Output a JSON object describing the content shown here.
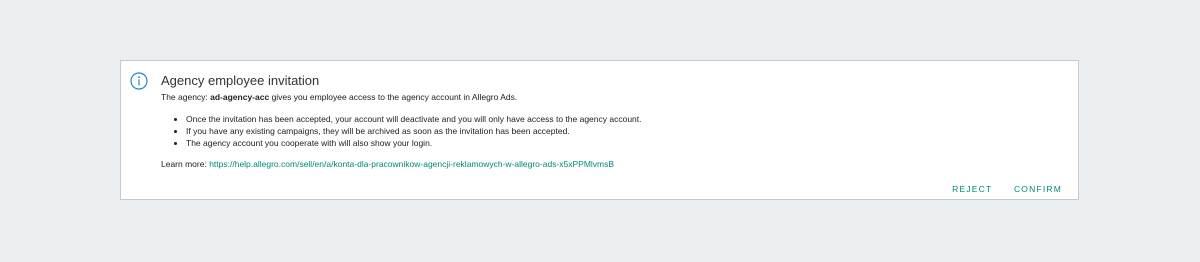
{
  "invitation": {
    "title": "Agency employee invitation",
    "desc_prefix": "The agency: ",
    "agency_name": "ad-agency-acc",
    "desc_suffix": " gives you employee access to the agency account in Allegro Ads.",
    "bullets": [
      "Once the invitation has been accepted, your account will deactivate and you will only have access to the agency account.",
      "If you have any existing campaigns, they will be archived as soon as the invitation has been accepted.",
      "The agency account you cooperate with will also show your login."
    ],
    "learn_more_label": "Learn more: ",
    "learn_more_url": "https://help.allegro.com/sell/en/a/konta-dla-pracownikow-agencji-reklamowych-w-allegro-ads-x5xPPMlvmsB",
    "reject_label": "REJECT",
    "confirm_label": "CONFIRM",
    "icon": "info-circle-icon",
    "accent_color": "#00897b"
  }
}
